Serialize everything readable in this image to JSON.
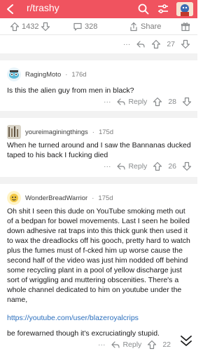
{
  "topbar": {
    "subreddit": "r/trashy",
    "bg": "#f0535f"
  },
  "postbar": {
    "upvotes": "1432",
    "comments": "328",
    "share_label": "Share",
    "more": "···",
    "vote_count": "27"
  },
  "comments": [
    {
      "username": "RagingMoto",
      "age": "176d",
      "body": "Is this the alien guy from men in black?",
      "reply_label": "Reply",
      "votes": "28",
      "more": "···"
    },
    {
      "username": "youreimaginingthings",
      "age": "175d",
      "body": "When he turned around and I saw the Bannanas ducked taped to his back I fucking died",
      "reply_label": "Reply",
      "votes": "26",
      "more": "···"
    },
    {
      "username": "WonderBreadWarrior",
      "age": "175d",
      "body": "Oh shit I seen this dude on YouTube smoking meth out of a bedpan for bowel movements. Last I seen he boiled down adhesive rat traps into this thick gunk then used it to wax the dreadlocks off his gooch, pretty hard to watch plus the fumes must of f-cked him up worse cause the second half of the video was just him nodded off behind some recycling plant in a pool of yellow discharge just sort of wriggling and muttering obscenities. There's a whole channel dedicated to him on youtube under the name,",
      "link": "https://youtube.com/user/blazeroyalcrips",
      "body2": "be forewarned though it's excruciatingly stupid.",
      "reply_label": "Reply",
      "votes": "22",
      "more": "···"
    }
  ],
  "icons": {
    "back": "back-arrow-icon",
    "search": "search-icon",
    "filter": "sliders-icon",
    "upvote": "upvote-arrow-icon",
    "downvote": "downvote-arrow-icon",
    "comment": "comment-bubble-icon",
    "share": "share-icon",
    "award": "award-icon",
    "reply": "reply-arrow-icon",
    "collapse": "double-chevron-down-icon"
  }
}
